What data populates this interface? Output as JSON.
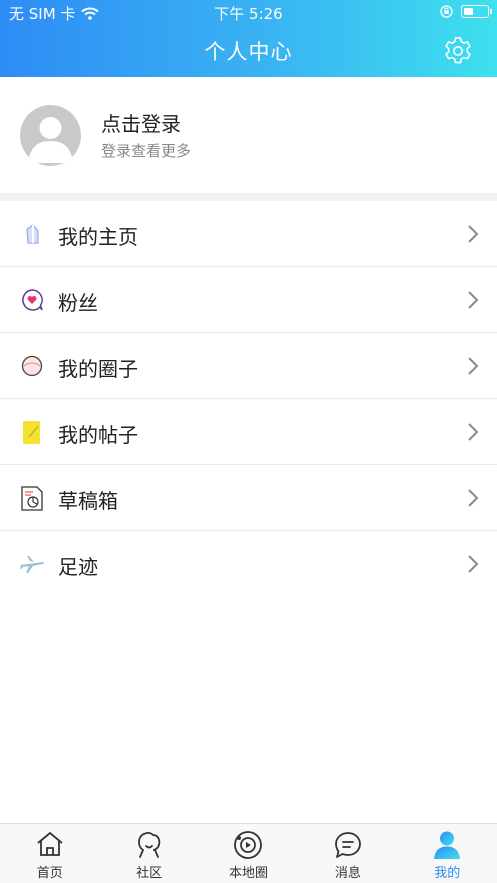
{
  "status_bar": {
    "carrier": "无 SIM 卡",
    "time": "下午 5:26",
    "battery_level": 0.45
  },
  "header": {
    "title": "个人中心",
    "settings_icon": "gear-icon"
  },
  "profile": {
    "title": "点击登录",
    "subtitle": "登录查看更多"
  },
  "menu": [
    {
      "label": "我的主页",
      "icon": "homepage-icon"
    },
    {
      "label": "粉丝",
      "icon": "fans-heart-icon"
    },
    {
      "label": "我的圈子",
      "icon": "circle-icon"
    },
    {
      "label": "我的帖子",
      "icon": "post-note-icon"
    },
    {
      "label": "草稿箱",
      "icon": "drafts-icon"
    },
    {
      "label": "足迹",
      "icon": "airplane-icon"
    }
  ],
  "tabbar": [
    {
      "label": "首页",
      "icon": "home-icon"
    },
    {
      "label": "社区",
      "icon": "community-icon"
    },
    {
      "label": "本地圈",
      "icon": "local-circle-icon"
    },
    {
      "label": "消息",
      "icon": "message-icon"
    },
    {
      "label": "我的",
      "icon": "profile-icon",
      "active": true
    }
  ],
  "colors": {
    "accent": "#2e8cf5",
    "header_gradient_end": "#3ee0ef"
  }
}
